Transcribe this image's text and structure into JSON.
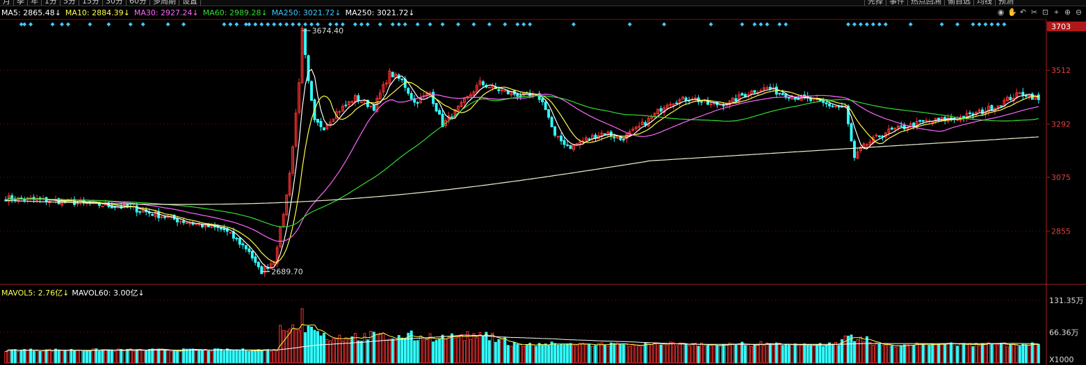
{
  "toolbar": {
    "period_tabs": [
      "月",
      "季",
      "年",
      "1分",
      "5分",
      "15分",
      "30分",
      "60分",
      "多周期",
      "设置"
    ],
    "right_tools": [
      "先择",
      "事件",
      "热点回溯",
      "偷自选",
      "均线",
      "预测"
    ]
  },
  "legend": {
    "ma5": {
      "label": "MA5: 2865.48↓",
      "color": "#ffffff"
    },
    "ma10": {
      "label": "MA10: 2884.39↓",
      "color": "#ffff4a"
    },
    "ma30": {
      "label": "MA30: 2927.24↓",
      "color": "#ff66ff"
    },
    "ma60": {
      "label": "MA60: 2989.28↓",
      "color": "#33dd33"
    },
    "ma250a": {
      "label": "MA250: 3021.72↓",
      "color": "#44c8ff"
    },
    "ma250b": {
      "label": "MA250: 3021.72↓",
      "color": "#ffffff"
    }
  },
  "vol_legend": {
    "mavol5": {
      "label": "MAVOL5: 2.76亿↓",
      "color": "#ffff4a"
    },
    "mavol60": {
      "label": "MAVOL60: 3.00亿↓",
      "color": "#ffffff"
    }
  },
  "colors": {
    "up": "#ff3333",
    "down": "#33ffff",
    "grid": "#7a1010",
    "axis_text": "#e04040",
    "current_tag": "#b01818"
  },
  "price_axis": {
    "ticks": [
      {
        "value": 3512,
        "label": "3512"
      },
      {
        "value": 3292,
        "label": "3292"
      },
      {
        "value": 3075,
        "label": "3075"
      },
      {
        "value": 2855,
        "label": "2855"
      }
    ],
    "current_price": "3703",
    "high_marker": {
      "value": 3674.4,
      "label": "3674.40"
    },
    "low_marker": {
      "value": 2689.7,
      "label": "2689.70"
    }
  },
  "volume_axis": {
    "ticks": [
      {
        "label": "131.35万"
      },
      {
        "label": "66.36万"
      },
      {
        "label": "X1000"
      }
    ]
  },
  "chart_data": {
    "type": "candlestick",
    "price_range": [
      2640,
      3720
    ],
    "keypoints": [
      [
        0,
        2990
      ],
      [
        20,
        2975
      ],
      [
        40,
        2950
      ],
      [
        55,
        2900
      ],
      [
        70,
        2860
      ],
      [
        78,
        2775
      ],
      [
        80,
        2720
      ],
      [
        81,
        2700
      ],
      [
        82,
        2690
      ],
      [
        86,
        2735
      ],
      [
        88,
        2860
      ],
      [
        90,
        3000
      ],
      [
        92,
        3200
      ],
      [
        94,
        3470
      ],
      [
        95,
        3674
      ],
      [
        97,
        3460
      ],
      [
        99,
        3300
      ],
      [
        102,
        3280
      ],
      [
        106,
        3340
      ],
      [
        112,
        3400
      ],
      [
        118,
        3360
      ],
      [
        123,
        3500
      ],
      [
        127,
        3470
      ],
      [
        131,
        3380
      ],
      [
        136,
        3420
      ],
      [
        140,
        3290
      ],
      [
        146,
        3370
      ],
      [
        152,
        3460
      ],
      [
        156,
        3440
      ],
      [
        161,
        3420
      ],
      [
        166,
        3410
      ],
      [
        171,
        3400
      ],
      [
        173,
        3360
      ],
      [
        176,
        3240
      ],
      [
        181,
        3200
      ],
      [
        186,
        3230
      ],
      [
        192,
        3260
      ],
      [
        197,
        3230
      ],
      [
        202,
        3270
      ],
      [
        207,
        3320
      ],
      [
        212,
        3380
      ],
      [
        216,
        3390
      ],
      [
        220,
        3400
      ],
      [
        226,
        3370
      ],
      [
        232,
        3380
      ],
      [
        236,
        3410
      ],
      [
        240,
        3430
      ],
      [
        244,
        3440
      ],
      [
        248,
        3420
      ],
      [
        254,
        3400
      ],
      [
        258,
        3390
      ],
      [
        264,
        3370
      ],
      [
        269,
        3360
      ],
      [
        272,
        3150
      ],
      [
        274,
        3190
      ],
      [
        277,
        3220
      ],
      [
        282,
        3260
      ],
      [
        288,
        3280
      ],
      [
        294,
        3300
      ],
      [
        300,
        3310
      ],
      [
        306,
        3320
      ],
      [
        312,
        3340
      ],
      [
        318,
        3370
      ],
      [
        322,
        3400
      ],
      [
        326,
        3420
      ],
      [
        330,
        3400
      ],
      [
        331,
        3390
      ]
    ],
    "ma250_start": 2980,
    "ma250_end": 3240,
    "ma250_min": 2960,
    "signal_markers": [
      5,
      6,
      8,
      15,
      18,
      20,
      27,
      33,
      40,
      44,
      52,
      57,
      70,
      72,
      74,
      77,
      78,
      80,
      82,
      84,
      86,
      88,
      90,
      92,
      94,
      96,
      98,
      100,
      104,
      106,
      108,
      112,
      114,
      116,
      120,
      124,
      126,
      128,
      132,
      136,
      140,
      145,
      150,
      155,
      160,
      164,
      166,
      168,
      182,
      200,
      211,
      226,
      236,
      240,
      242,
      244,
      248,
      250,
      270,
      272,
      274,
      276,
      278,
      280,
      282,
      290,
      300,
      305,
      310,
      312,
      314,
      316,
      318,
      320
    ],
    "volume_range": [
      0,
      140
    ],
    "volume_baseline": 25
  }
}
